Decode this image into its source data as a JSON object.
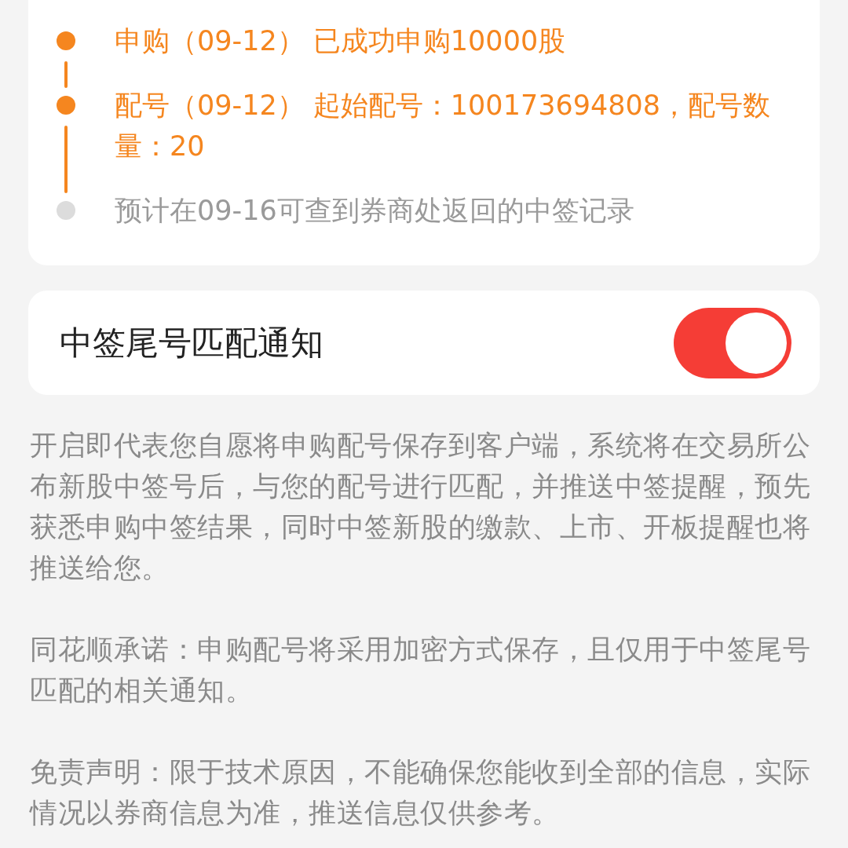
{
  "timeline": [
    {
      "text": "申购（09-12） 已成功申购10000股",
      "done": true
    },
    {
      "text": "配号（09-12） 起始配号：100173694808，配号数量：20",
      "done": true
    },
    {
      "text": "预计在09-16可查到券商处返回的中签记录",
      "done": false
    }
  ],
  "notification": {
    "label": "中签尾号匹配通知",
    "on": true
  },
  "notes": [
    "开启即代表您自愿将申购配号保存到客户端，系统将在交易所公布新股中签号后，与您的配号进行匹配，并推送中签提醒，预先获悉申购中签结果，同时中签新股的缴款、上市、开板提醒也将推送给您。",
    "同花顺承诺：申购配号将采用加密方式保存，且仅用于中签尾号匹配的相关通知。",
    "免责声明：限于技术原因，不能确保您能收到全部的信息，实际情况以券商信息为准，推送信息仅供参考。"
  ]
}
